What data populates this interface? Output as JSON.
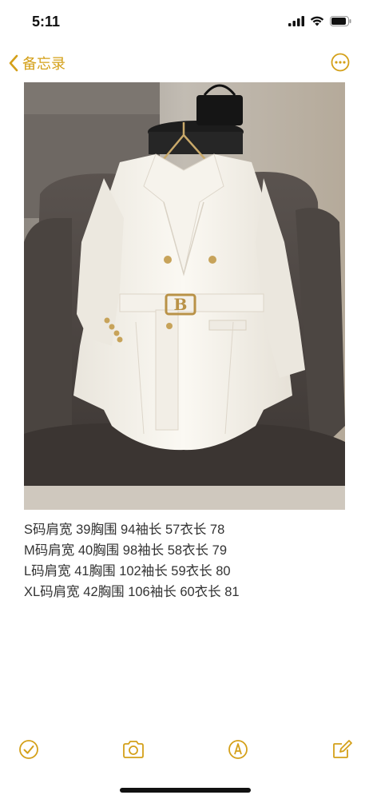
{
  "status_bar": {
    "time": "5:11"
  },
  "nav": {
    "back_label": "备忘录"
  },
  "photo": {
    "alt": "white double-breasted belted blazer on leather chair",
    "buckle_letter": "B"
  },
  "note": {
    "lines": [
      "S码肩宽 39胸围 94袖长 57衣长 78",
      "M码肩宽 40胸围 98袖长 58衣长 79",
      "L码肩宽 41胸围 102袖长 59衣长 80",
      "XL码肩宽 42胸围 106袖长 60衣长 81"
    ]
  },
  "toolbar": {
    "items": [
      "checklist-icon",
      "camera-icon",
      "markup-icon",
      "compose-icon"
    ]
  },
  "colors": {
    "accent": "#d4a019"
  }
}
